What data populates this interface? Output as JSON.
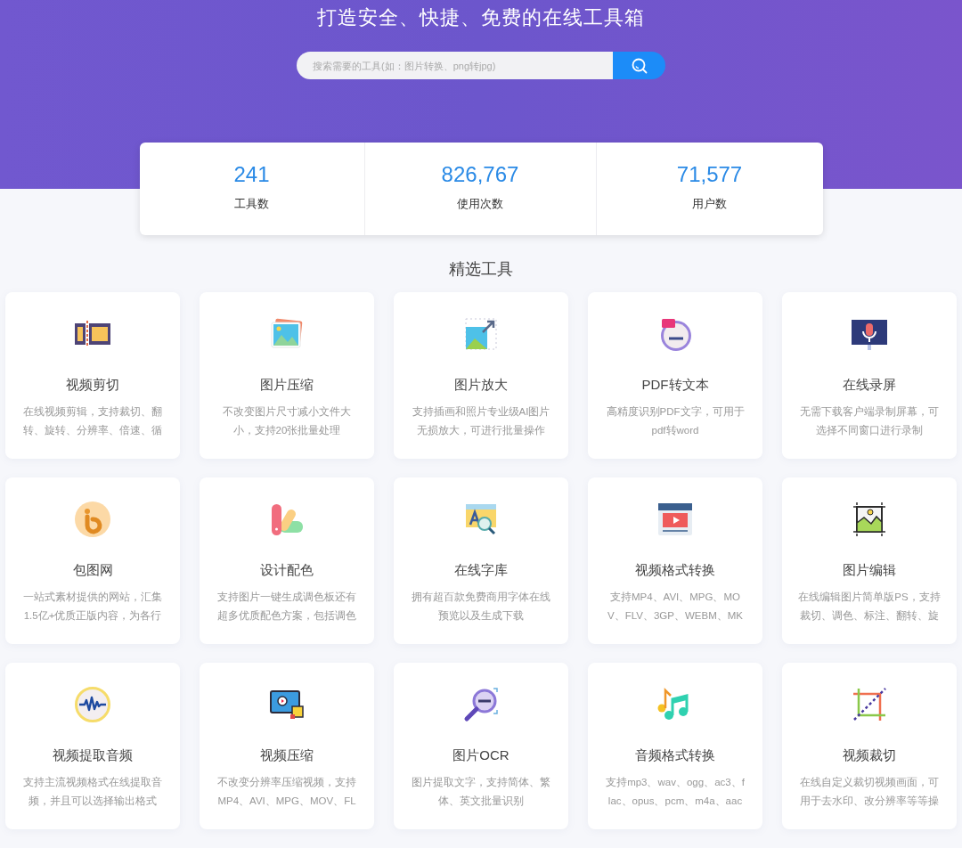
{
  "hero": {
    "title": "打造安全、快捷、免费的在线工具箱",
    "search": {
      "placeholder": "搜索需要的工具(如：图片转换、png转jpg)"
    }
  },
  "stats": [
    {
      "value": "241",
      "label": "工具数"
    },
    {
      "value": "826,767",
      "label": "使用次数"
    },
    {
      "value": "71,577",
      "label": "用户数"
    }
  ],
  "section_title": "精选工具",
  "tools": [
    {
      "name": "视频剪切",
      "desc": [
        "在线视频剪辑，支持裁切、翻",
        "转、旋转、分辨率、倍速、循"
      ]
    },
    {
      "name": "图片压缩",
      "desc": [
        "不改变图片尺寸减小文件大",
        "小，支持20张批量处理"
      ]
    },
    {
      "name": "图片放大",
      "desc": [
        "支持插画和照片专业级AI图片",
        "无损放大，可进行批量操作"
      ]
    },
    {
      "name": "PDF转文本",
      "desc": [
        "高精度识别PDF文字，可用于",
        "pdf转word"
      ]
    },
    {
      "name": "在线录屏",
      "desc": [
        "无需下载客户端录制屏幕，可",
        "选择不同窗口进行录制"
      ]
    },
    {
      "name": "包图网",
      "desc": [
        "一站式素材提供的网站，汇集",
        "1.5亿+优质正版内容，为各行"
      ]
    },
    {
      "name": "设计配色",
      "desc": [
        "支持图片一键生成调色板还有",
        "超多优质配色方案，包括调色"
      ]
    },
    {
      "name": "在线字库",
      "desc": [
        "拥有超百款免费商用字体在线",
        "预览以及生成下载"
      ]
    },
    {
      "name": "视频格式转换",
      "desc": [
        "支持MP4、AVI、MPG、MO",
        "V、FLV、3GP、WEBM、MK"
      ]
    },
    {
      "name": "图片编辑",
      "desc": [
        "在线编辑图片简单版PS，支持",
        "裁切、调色、标注、翻转、旋"
      ]
    },
    {
      "name": "视频提取音频",
      "desc": [
        "支持主流视频格式在线提取音",
        "频，并且可以选择输出格式"
      ]
    },
    {
      "name": "视频压缩",
      "desc": [
        "不改变分辨率压缩视频，支持",
        "MP4、AVI、MPG、MOV、FL"
      ]
    },
    {
      "name": "图片OCR",
      "desc": [
        "图片提取文字，支持简体、繁",
        "体、英文批量识别"
      ]
    },
    {
      "name": "音频格式转换",
      "desc": [
        "支持mp3、wav、ogg、ac3、f",
        "lac、opus、pcm、m4a、aac"
      ]
    },
    {
      "name": "视频裁切",
      "desc": [
        "在线自定义裁切视频画面，可",
        "用于去水印、改分辨率等等操"
      ]
    }
  ]
}
